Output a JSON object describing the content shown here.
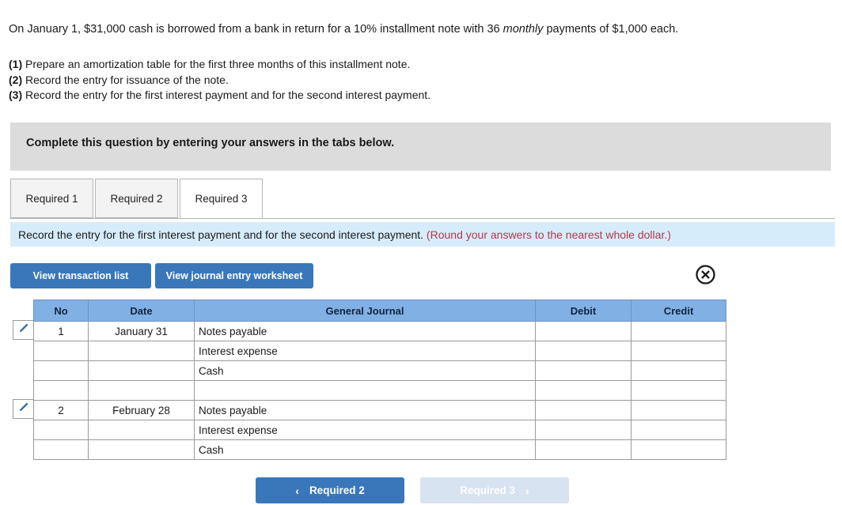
{
  "question": {
    "stem_before_em": "On January 1, $31,000 cash is borrowed from a bank in return for a 10% installment note with 36 ",
    "stem_em": "monthly",
    "stem_after_em": " payments of $1,000 each.",
    "requirements": [
      {
        "num": "(1)",
        "text": " Prepare an amortization table for the first three months of this installment note."
      },
      {
        "num": "(2)",
        "text": " Record the entry for issuance of the note."
      },
      {
        "num": "(3)",
        "text": " Record the entry for the first interest payment and for the second interest payment."
      }
    ]
  },
  "banner": {
    "text": "Complete this question by entering your answers in the tabs below."
  },
  "tabs": {
    "items": [
      {
        "label": "Required 1",
        "active": false
      },
      {
        "label": "Required 2",
        "active": false
      },
      {
        "label": "Required 3",
        "active": true
      }
    ]
  },
  "subbar": {
    "text": "Record the entry for the first interest payment and for the second interest payment.",
    "note": " (Round your answers to the nearest whole dollar.)"
  },
  "toolbar": {
    "view_transaction_list": "View transaction list",
    "view_journal_worksheet": "View journal entry worksheet",
    "close_icon": "close-circle-icon"
  },
  "journal": {
    "headers": {
      "no": "No",
      "date": "Date",
      "general_journal": "General Journal",
      "debit": "Debit",
      "credit": "Credit"
    },
    "rows": [
      {
        "edit": true,
        "no": "1",
        "date": "January 31",
        "account": "Notes payable",
        "debit": "",
        "credit": ""
      },
      {
        "edit": false,
        "no": "",
        "date": "",
        "account": "Interest expense",
        "debit": "",
        "credit": ""
      },
      {
        "edit": false,
        "no": "",
        "date": "",
        "account": "Cash",
        "debit": "",
        "credit": ""
      },
      {
        "edit": false,
        "no": "",
        "date": "",
        "account": "",
        "debit": "",
        "credit": ""
      },
      {
        "edit": true,
        "no": "2",
        "date": "February 28",
        "account": "Notes payable",
        "debit": "",
        "credit": ""
      },
      {
        "edit": false,
        "no": "",
        "date": "",
        "account": "Interest expense",
        "debit": "",
        "credit": ""
      },
      {
        "edit": false,
        "no": "",
        "date": "",
        "account": "Cash",
        "debit": "",
        "credit": ""
      }
    ]
  },
  "nav": {
    "prev_label": "Required 2",
    "next_label": "Required 3",
    "prev_chevron": "‹",
    "next_chevron": "›"
  },
  "colors": {
    "primary_blue": "#3a77ba",
    "table_header_blue": "#81b0e4",
    "subbar_blue": "#d7ecfa",
    "banner_grey": "#dcdcdc",
    "note_red": "#b03a4a",
    "disabled_blue": "#d7e3f0"
  }
}
